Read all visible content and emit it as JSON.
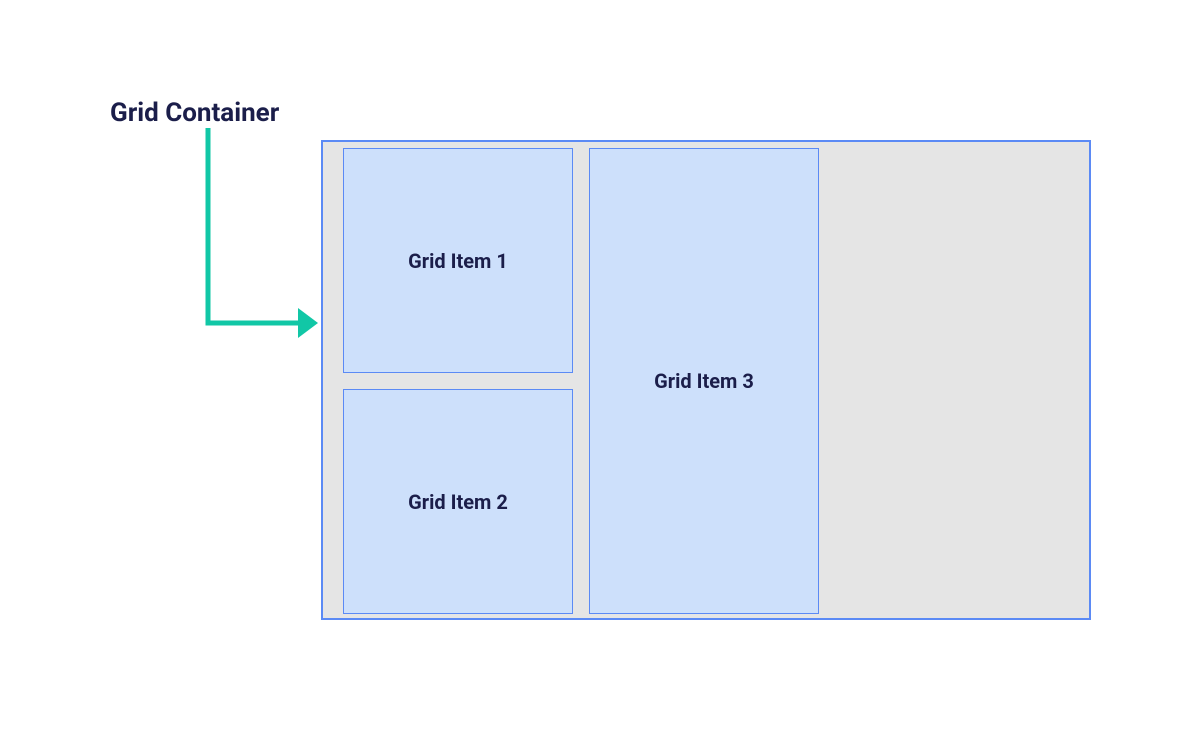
{
  "title": "Grid Container",
  "items": {
    "item1": "Grid Item 1",
    "item2": "Grid Item 2",
    "item3": "Grid Item 3"
  },
  "colors": {
    "text": "#1b1e4a",
    "arrow": "#11c7a6",
    "cell_fill": "#cde0fb",
    "cell_border": "#5b8af5",
    "container_bg": "#e5e5e5"
  }
}
